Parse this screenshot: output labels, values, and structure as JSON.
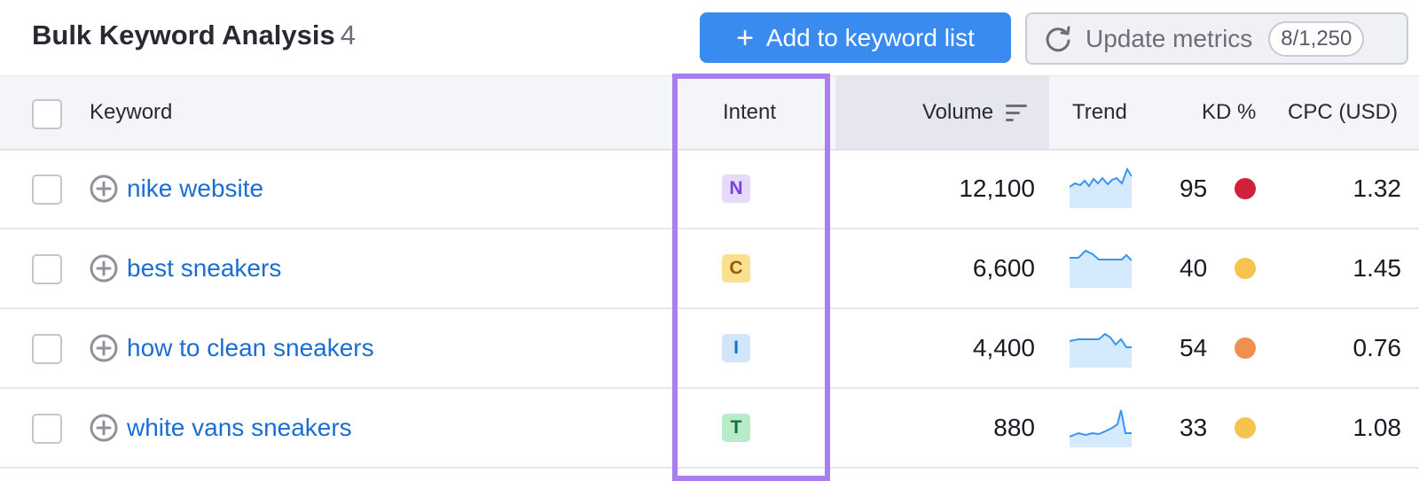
{
  "header": {
    "title": "Bulk Keyword Analysis",
    "count": "4",
    "add_button_label": "Add to keyword list",
    "update_button_label": "Update metrics",
    "update_quota": "8/1,250"
  },
  "table": {
    "columns": {
      "keyword": "Keyword",
      "intent": "Intent",
      "volume": "Volume",
      "trend": "Trend",
      "kd": "KD %",
      "cpc": "CPC (USD)"
    },
    "rows": [
      {
        "keyword": "nike website",
        "intent": "N",
        "volume": "12,100",
        "kd": "95",
        "cpc": "1.32"
      },
      {
        "keyword": "best sneakers",
        "intent": "C",
        "volume": "6,600",
        "kd": "40",
        "cpc": "1.45"
      },
      {
        "keyword": "how to clean sneakers",
        "intent": "I",
        "volume": "4,400",
        "kd": "54",
        "cpc": "0.76"
      },
      {
        "keyword": "white vans sneakers",
        "intent": "T",
        "volume": "880",
        "kd": "33",
        "cpc": "1.08"
      }
    ]
  },
  "colors": {
    "primary_button": "#3a8bf0",
    "link": "#1a6dd3",
    "highlight_border": "#a97ff0",
    "intent_navigational": "#e5dafc",
    "intent_commercial": "#fbe18f",
    "intent_informational": "#d2e6fb",
    "intent_transactional": "#b8ecc8",
    "kd_very_hard": "#d0213a",
    "kd_possible": "#f6c34f",
    "kd_difficult": "#f0904c"
  },
  "icons": {
    "add": "plus-icon",
    "update": "refresh-icon",
    "sort": "sort-icon",
    "row_add": "circle-plus-icon"
  }
}
